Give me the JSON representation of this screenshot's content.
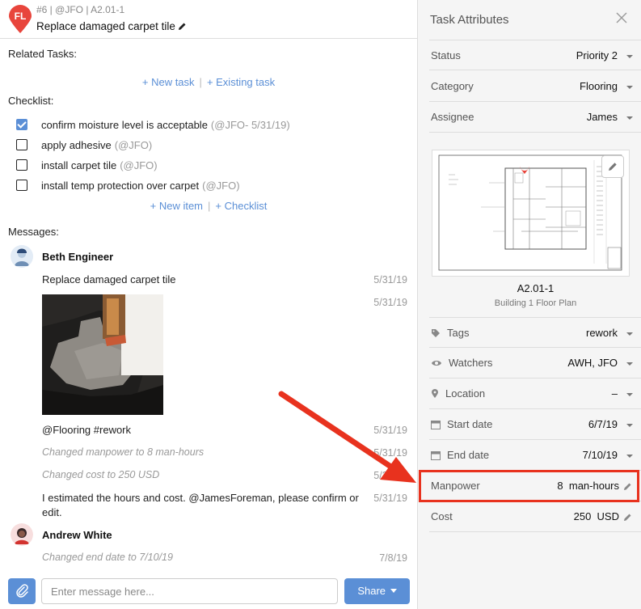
{
  "header": {
    "pin_initials": "FL",
    "meta": "#6 | @JFO | A2.01-1",
    "title": "Replace damaged carpet tile"
  },
  "related_tasks": {
    "label": "Related Tasks:",
    "new_task": "+ New task",
    "separator": "|",
    "existing_task": "+ Existing task"
  },
  "checklist": {
    "label": "Checklist:",
    "items": [
      {
        "text": "confirm moisture level is acceptable",
        "meta": "(@JFO- 5/31/19)",
        "checked": true
      },
      {
        "text": "apply adhesive",
        "meta": "(@JFO)",
        "checked": false
      },
      {
        "text": "install carpet tile",
        "meta": "(@JFO)",
        "checked": false
      },
      {
        "text": "install temp protection over carpet",
        "meta": "(@JFO)",
        "checked": false
      }
    ],
    "new_item": "+ New item",
    "separator": "|",
    "new_checklist": "+ Checklist"
  },
  "messages": {
    "label": "Messages:",
    "threads": [
      {
        "author": "Beth Engineer",
        "entries": [
          {
            "text": "Replace damaged carpet tile",
            "date": "5/31/19"
          },
          {
            "text": "",
            "date": "5/31/19",
            "type": "photo"
          },
          {
            "text": "@Flooring #rework",
            "date": "5/31/19"
          },
          {
            "text": "Changed manpower to 8 man-hours",
            "date": "5/31/19",
            "type": "system"
          },
          {
            "text": "Changed cost to 250 USD",
            "date": "5/31/19",
            "type": "system"
          },
          {
            "text": "I estimated the hours and cost. @JamesForeman, please confirm or",
            "text_cont": "edit.",
            "date": "5/31/19"
          }
        ]
      },
      {
        "author": "Andrew White",
        "entries": [
          {
            "text": "Changed end date to 7/10/19",
            "date": "7/8/19",
            "type": "system"
          }
        ]
      }
    ]
  },
  "composer": {
    "placeholder": "Enter message here...",
    "share_label": "Share"
  },
  "attributes": {
    "title": "Task Attributes",
    "rows": [
      {
        "label": "Status",
        "value": "Priority 2"
      },
      {
        "label": "Category",
        "value": "Flooring"
      },
      {
        "label": "Assignee",
        "value": "James"
      }
    ],
    "sheet": {
      "name": "A2.01-1",
      "subtitle": "Building 1 Floor Plan"
    },
    "rows2": [
      {
        "label": "Tags",
        "value": "rework",
        "icon": "tag-icon"
      },
      {
        "label": "Watchers",
        "value": "AWH, JFO",
        "icon": "eye-icon"
      },
      {
        "label": "Location",
        "value": "–",
        "icon": "location-pin-icon"
      },
      {
        "label": "Start date",
        "value": "6/7/19",
        "icon": "calendar-icon"
      },
      {
        "label": "End date",
        "value": "7/10/19",
        "icon": "calendar-icon"
      }
    ],
    "manpower": {
      "label": "Manpower",
      "value": "8",
      "unit": "man-hours"
    },
    "cost": {
      "label": "Cost",
      "value": "250",
      "unit": "USD"
    }
  },
  "colors": {
    "accent": "#5b8fd6",
    "pin": "#e8453c",
    "highlight": "#e8321e"
  }
}
